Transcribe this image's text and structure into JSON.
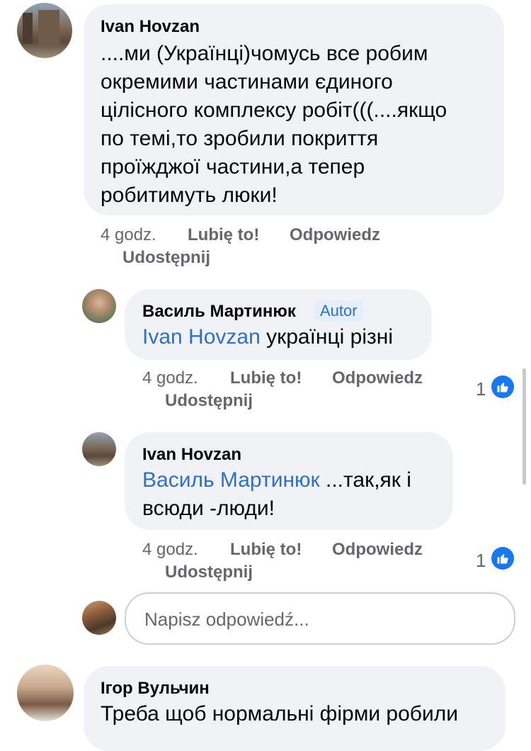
{
  "comments": [
    {
      "author": "Ivan Hovzan",
      "lines": [
        "....ми (Українці)чомусь все робим",
        "окремими частинами єдиного",
        "цілісного комплексу робіт(((....якщо",
        "по темі,то зробили покриття",
        "проїжджої частини,а тепер",
        "робитимуть люки!"
      ],
      "time": "4 godz.",
      "like": "Lubię to!",
      "reply": "Odpowiedz",
      "share": "Udostępnij"
    },
    {
      "author": "Василь Мартинюк",
      "badge": "Autor",
      "mention": "Ivan Hovzan",
      "text": " українці різні",
      "time": "4 godz.",
      "like": "Lubię to!",
      "reply": "Odpowiedz",
      "share": "Udostępnij",
      "reactions": "1"
    },
    {
      "author": "Ivan Hovzan",
      "mention": "Василь Мартинюк",
      "text": " ...так,як і",
      "line2": "всюди -люди!",
      "time": "4 godz.",
      "like": "Lubię to!",
      "reply": "Odpowiedz",
      "share": "Udostępnij",
      "reactions": "1"
    },
    {
      "author": "Ігор Вульчин",
      "text": "Треба щоб нормальні фірми робили"
    }
  ],
  "reply_box": {
    "placeholder": "Napisz odpowiedź..."
  },
  "colors": {
    "link": "#2f6fc9",
    "bubble": "#f0f2f5",
    "like": "#1877f2",
    "meta": "#65676b"
  },
  "icons": {
    "like": "thumbs-up-icon"
  }
}
